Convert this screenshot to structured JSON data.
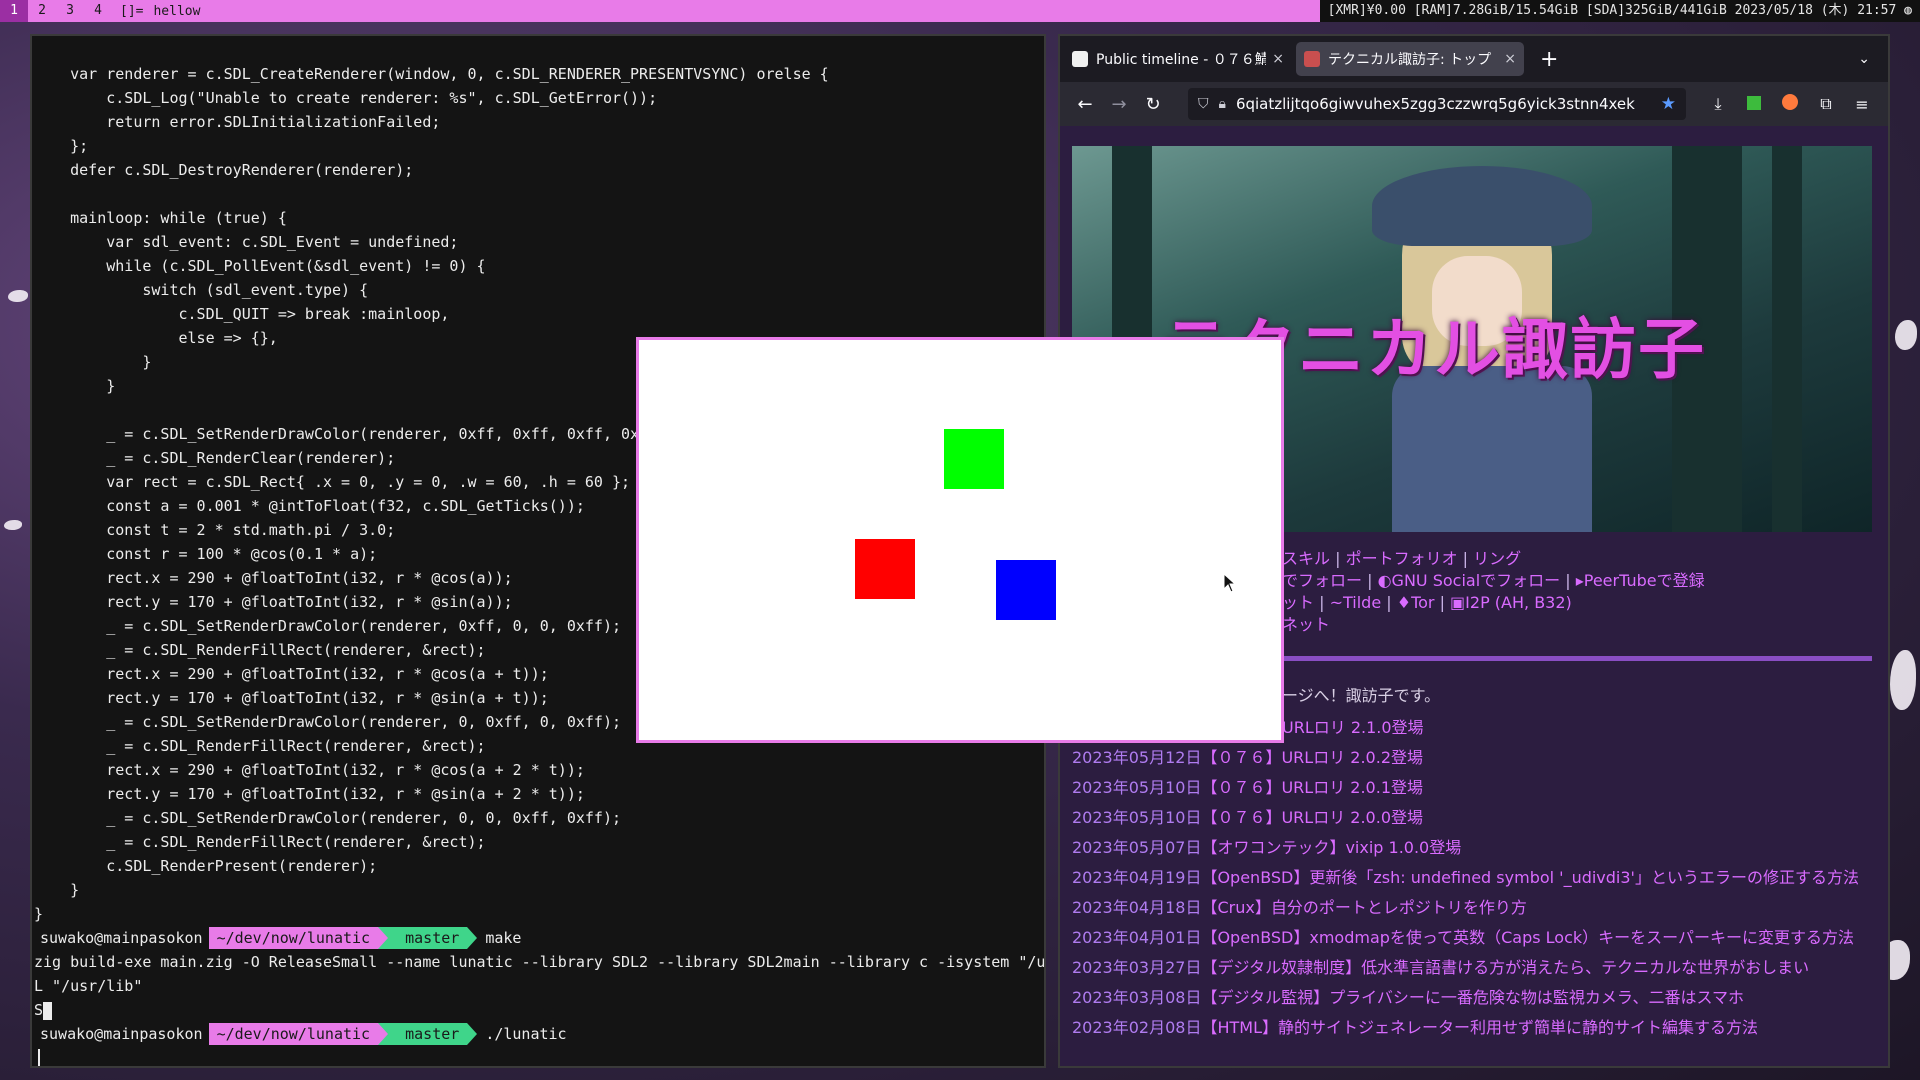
{
  "bar": {
    "tags": [
      "1",
      "2",
      "3",
      "4"
    ],
    "layout": "[]=",
    "window_title": "hellow",
    "status": "[XMR]¥0.00 [RAM]7.28GiB/15.54GiB [SDA]325GiB/441GiB 2023/05/18 (木) 21:57 ◍"
  },
  "terminal": {
    "code_lines": [
      "    var renderer = c.SDL_CreateRenderer(window, 0, c.SDL_RENDERER_PRESENTVSYNC) orelse {",
      "        c.SDL_Log(\"Unable to create renderer: %s\", c.SDL_GetError());",
      "        return error.SDLInitializationFailed;",
      "    };",
      "    defer c.SDL_DestroyRenderer(renderer);",
      "",
      "    mainloop: while (true) {",
      "        var sdl_event: c.SDL_Event = undefined;",
      "        while (c.SDL_PollEvent(&sdl_event) != 0) {",
      "            switch (sdl_event.type) {",
      "                c.SDL_QUIT => break :mainloop,",
      "                else => {},",
      "            }",
      "        }",
      "",
      "        _ = c.SDL_SetRenderDrawColor(renderer, 0xff, 0xff, 0xff, 0xff);",
      "        _ = c.SDL_RenderClear(renderer);",
      "        var rect = c.SDL_Rect{ .x = 0, .y = 0, .w = 60, .h = 60 };",
      "        const a = 0.001 * @intToFloat(f32, c.SDL_GetTicks());",
      "        const t = 2 * std.math.pi / 3.0;",
      "        const r = 100 * @cos(0.1 * a);",
      "        rect.x = 290 + @floatToInt(i32, r * @cos(a));",
      "        rect.y = 170 + @floatToInt(i32, r * @sin(a));",
      "        _ = c.SDL_SetRenderDrawColor(renderer, 0xff, 0, 0, 0xff);",
      "        _ = c.SDL_RenderFillRect(renderer, &rect);",
      "        rect.x = 290 + @floatToInt(i32, r * @cos(a + t));",
      "        rect.y = 170 + @floatToInt(i32, r * @sin(a + t));",
      "        _ = c.SDL_SetRenderDrawColor(renderer, 0, 0xff, 0, 0xff);",
      "        _ = c.SDL_RenderFillRect(renderer, &rect);",
      "        rect.x = 290 + @floatToInt(i32, r * @cos(a + 2 * t));",
      "        rect.y = 170 + @floatToInt(i32, r * @sin(a + 2 * t));",
      "        _ = c.SDL_SetRenderDrawColor(renderer, 0, 0, 0xff, 0xff);",
      "        _ = c.SDL_RenderFillRect(renderer, &rect);",
      "        c.SDL_RenderPresent(renderer);",
      "    }",
      "}"
    ],
    "prompt1": {
      "user": "suwako@mainpasokon",
      "dir": "~/dev/now/lunatic",
      "git": " master",
      "cmd": "make"
    },
    "output_lines": [
      "zig build-exe main.zig -O ReleaseSmall --name lunatic --library SDL2 --library SDL2main --library c -isystem \"/usr/include\"  -",
      "L \"/usr/lib\""
    ],
    "output_partial": "S",
    "prompt2": {
      "user": "suwako@mainpasokon",
      "dir": "~/dev/now/lunatic",
      "git": " master",
      "cmd": "./lunatic"
    }
  },
  "browser": {
    "tabs": [
      {
        "label": "Public timeline - ０７６鯖",
        "close": "×"
      },
      {
        "label": "テクニカル諏訪子: トップ",
        "close": "×"
      }
    ],
    "new_tab": "+",
    "url": "6qiatzlijtqo6giwvuhex5zgg3czzwrq5g6yick3stnn4xek",
    "page": {
      "hero_title": "テクニカル諏訪子",
      "nav_row1": [
        {
          "text": "スキル",
          "sep": " | "
        },
        {
          "text": "ポートフォリオ",
          "sep": " | "
        },
        {
          "text": "リング",
          "sep": ""
        }
      ],
      "nav_row2": [
        {
          "text": "でフォロー",
          "sep": " | "
        },
        {
          "text": "GNU Socialでフォロー",
          "sep": " | "
        },
        {
          "text": "PeerTubeで登録",
          "sep": ""
        }
      ],
      "nav_row3": [
        {
          "text": "ット",
          "sep": " | "
        },
        {
          "text": "Tilde",
          "sep": " | "
        },
        {
          "text": "Tor",
          "sep": " | "
        },
        {
          "text": "I2P (AH, B32)",
          "sep": ""
        }
      ],
      "nav_row4": "ネット",
      "welcome": "ージへ！諏訪子です。",
      "news": [
        {
          "date": "",
          "title": "URLロリ 2.1.0登場"
        },
        {
          "date": "2023年05月12日",
          "title": "【０７６】URLロリ 2.0.2登場"
        },
        {
          "date": "2023年05月10日",
          "title": "【０７６】URLロリ 2.0.1登場"
        },
        {
          "date": "2023年05月10日",
          "title": "【０７６】URLロリ 2.0.0登場"
        },
        {
          "date": "2023年05月07日",
          "title": "【オワコンテック】vixip 1.0.0登場"
        },
        {
          "date": "2023年04月19日",
          "title": "【OpenBSD】更新後「zsh: undefined symbol '_udivdi3'」というエラーの修正する方法"
        },
        {
          "date": "2023年04月18日",
          "title": "【Crux】自分のポートとレポジトリを作り方"
        },
        {
          "date": "2023年04月01日",
          "title": "【OpenBSD】xmodmapを使って英数（Caps Lock）キーをスーパーキーに変更する方法"
        },
        {
          "date": "2023年03月27日",
          "title": "【デジタル奴隷制度】低水準言語書ける方が消えたら、テクニカルな世界がおしまい"
        },
        {
          "date": "2023年03月08日",
          "title": "【デジタル監視】プライバシーに一番危険な物は監視カメラ、二番はスマホ"
        },
        {
          "date": "2023年02月08日",
          "title": "【HTML】静的サイトジェネレーター利用せず簡単に静的サイト編集する方法"
        }
      ]
    }
  },
  "sdl_window": {
    "squares": [
      {
        "name": "green-square",
        "color": "#00ff00"
      },
      {
        "name": "red-square",
        "color": "#ff0000"
      },
      {
        "name": "blue-square",
        "color": "#0000ff"
      }
    ]
  },
  "colors": {
    "accent": "#e87be8",
    "git": "#3fd58a",
    "link": "#d96bff"
  }
}
